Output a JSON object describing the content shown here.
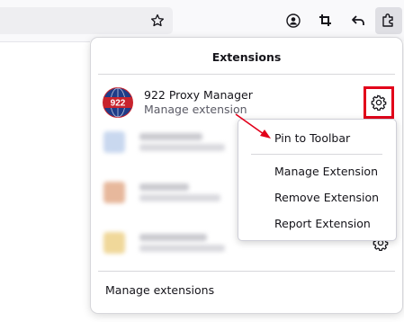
{
  "toolbar": {
    "icons": [
      "star-icon",
      "account-icon",
      "screenshot-crop-icon",
      "back-arrow-icon",
      "extensions-puzzle-icon"
    ]
  },
  "panel": {
    "title": "Extensions",
    "extension": {
      "name": "922 Proxy Manager",
      "subtitle": "Manage extension",
      "logo_text": "922"
    },
    "manage_link": "Manage extensions"
  },
  "context_menu": {
    "pin": "Pin to Toolbar",
    "manage": "Manage Extension",
    "remove": "Remove Extension",
    "report": "Report Extension"
  },
  "colors": {
    "highlight": "#e2001a",
    "annotation_arrow": "#e2001a",
    "logo_red": "#c8232d"
  }
}
